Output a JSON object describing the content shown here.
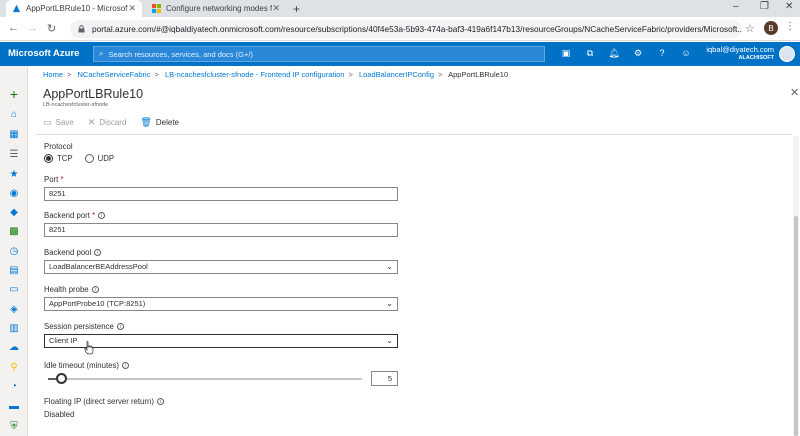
{
  "browser": {
    "tabs": [
      {
        "title": "AppPortLBRule10 - Microsoft Az",
        "active": true
      },
      {
        "title": "Configure networking modes for",
        "active": false
      }
    ],
    "url": "portal.azure.com/#@iqbaldiyatech.onmicrosoft.com/resource/subscriptions/40f4e53a-5b93-474a-baf3-419a6f147b13/resourceGroups/NCacheServiceFabric/providers/Microsoft....",
    "profile_initial": "B"
  },
  "azure": {
    "brand": "Microsoft Azure",
    "search_placeholder": "Search resources, services, and docs (G+/)",
    "account_email": "iqbal@diyatech.com",
    "account_org": "ALACHISOFT"
  },
  "breadcrumb": {
    "items": [
      "Home",
      "NCacheServiceFabric",
      "LB-ncachesfcluster-sfnode - Frontend IP configuration",
      "LoadBalancerIPConfig"
    ],
    "current": "AppPortLBRule10"
  },
  "blade": {
    "title": "AppPortLBRule10",
    "subtitle": "LB-ncachesfcluster-sfnode"
  },
  "toolbar": {
    "save_label": "Save",
    "discard_label": "Discard",
    "delete_label": "Delete"
  },
  "form": {
    "protocol_label": "Protocol",
    "protocol_options": [
      "TCP",
      "UDP"
    ],
    "protocol_selected": "TCP",
    "port_label": "Port",
    "port_value": "8251",
    "backend_port_label": "Backend port",
    "backend_port_value": "8251",
    "backend_pool_label": "Backend pool",
    "backend_pool_value": "LoadBalancerBEAddressPool",
    "health_probe_label": "Health probe",
    "health_probe_value": "AppPortProbe10 (TCP:8251)",
    "session_persistence_label": "Session persistence",
    "session_persistence_value": "Client IP",
    "idle_timeout_label": "Idle timeout (minutes)",
    "idle_timeout_value": "5",
    "idle_timeout_fraction": 0.04,
    "floating_ip_label": "Floating IP (direct server return)",
    "floating_ip_value": "Disabled"
  },
  "colors": {
    "azure_blue": "#0072c6",
    "link_blue": "#0078d4"
  }
}
